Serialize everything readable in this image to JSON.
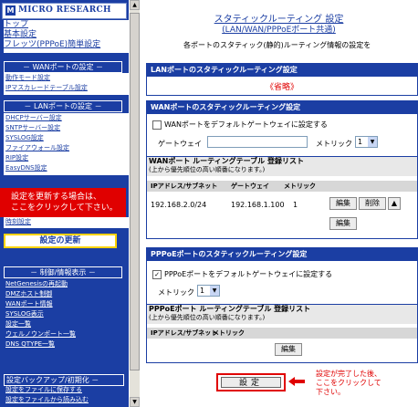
{
  "sidebar": {
    "logo_mark": "M",
    "logo_text": "MICRO RESEARCH",
    "top_links": [
      "トップ",
      "基本設定",
      "フレッツ(PPPoE)簡単設定"
    ],
    "wan_section_title": "－ WANポートの設定 －",
    "wan_items": [
      "動作モード設定",
      "IPマスカレードテーブル設定"
    ],
    "lan_section_title": "－ LANポートの設定 －",
    "lan_items": [
      "DHCPサーバー設定",
      "SNTPサーバー設定",
      "SYSLOG設定",
      "ファイアウォール設定",
      "RIP設定",
      "EasyDNS設定"
    ],
    "hidden_item": "時刻設定",
    "callout_text": [
      "設定を更新する場合は、",
      "ここをクリックして下さい。"
    ],
    "update_button": "設定の更新",
    "control_section_title": "－ 制御/情報表示 －",
    "control_items": [
      "NetGenesisの再起動",
      "DMZホスト制御",
      "WANポート情報",
      "SYSLOG表示",
      "設定一覧",
      "ウェルノウンポート一覧",
      "DNS QTYPE一覧"
    ],
    "backup_section_title": "設定バックアップ/初期化 －",
    "backup_items": [
      "設定をファイルに保存する",
      "設定をファイルから読み込む"
    ]
  },
  "header": {
    "title": "スタティックルーティング 設定",
    "subtitle": "(LAN/WAN/PPPoEポート共通)",
    "description": "各ポートのスタティック(静的)ルーティング情報の設定を"
  },
  "lan_panel": {
    "title": "LANポートのスタティックルーティング設定",
    "omitted": "《省略》"
  },
  "wan_panel": {
    "title": "WANポートのスタティックルーティング設定",
    "default_gw_label": "WANポートをデフォルトゲートウェイに設定する",
    "default_gw_checked": false,
    "gateway_label": "ゲートウェイ",
    "gateway_value": "",
    "metric_label": "メトリック",
    "metric_value": "1",
    "list_title": "WANポート ルーティングテーブル 登録リスト",
    "list_subtitle": "(上から優先順位の高い順番になります。)",
    "columns": [
      "IPアドレス/サブネット",
      "ゲートウェイ",
      "メトリック"
    ],
    "rows": [
      {
        "subnet": "192.168.2.0/24",
        "gateway": "192.168.1.100",
        "metric": "1",
        "edit": "編集",
        "delete": "削除",
        "up": "▲"
      }
    ],
    "new_edit": "編集"
  },
  "pppoe_panel": {
    "title": "PPPoEポートのスタティックルーティング設定",
    "default_gw_label": "PPPoEポートをデフォルトゲートウェイに設定する",
    "default_gw_checked": true,
    "metric_label": "メトリック",
    "metric_value": "1",
    "list_title": "PPPoEポート ルーティングテーブル 登録リスト",
    "list_subtitle": "(上から優先順位の高い順番になります。)",
    "columns": [
      "IPアドレス/サブネット",
      "メトリック"
    ],
    "new_edit": "編集"
  },
  "footer": {
    "set_button": "設定",
    "note": [
      "設定が完了した後、",
      "ここをクリックして",
      "下さい。"
    ]
  },
  "colors": {
    "primary": "#1b3ea3",
    "callout": "#e00000",
    "highlight": "#ffd300"
  }
}
